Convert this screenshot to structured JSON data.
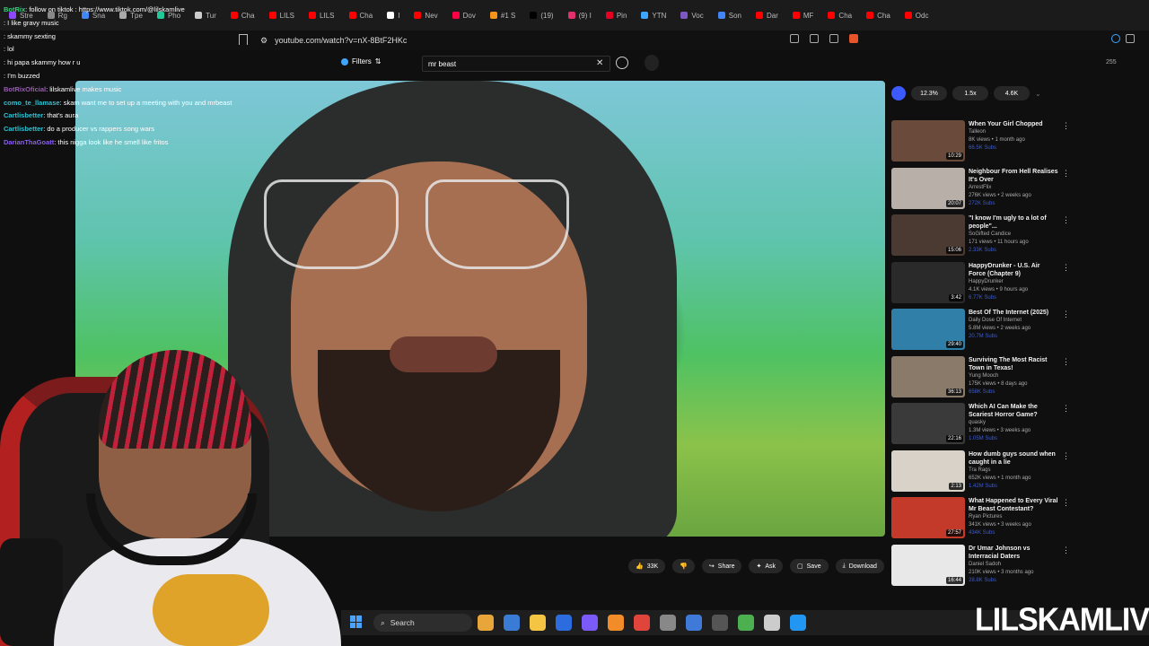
{
  "browser": {
    "tabs": [
      {
        "label": "Stre",
        "color": "#9146ff"
      },
      {
        "label": "Rg",
        "color": "#888888"
      },
      {
        "label": "Sna",
        "color": "#4285f4"
      },
      {
        "label": "Tpe",
        "color": "#aaaaaa"
      },
      {
        "label": "Pho",
        "color": "#20c997"
      },
      {
        "label": "Tur",
        "color": "#cccccc"
      },
      {
        "label": "Cha",
        "color": "#ff0000"
      },
      {
        "label": "LILS",
        "color": "#ff0000"
      },
      {
        "label": "LILS",
        "color": "#ff0000"
      },
      {
        "label": "Cha",
        "color": "#ff0000"
      },
      {
        "label": "I",
        "color": "#ffffff"
      },
      {
        "label": "Nev",
        "color": "#ff0000"
      },
      {
        "label": "Dov",
        "color": "#ff0044"
      },
      {
        "label": "#1 S",
        "color": "#f7931a"
      },
      {
        "label": "(19)",
        "color": "#000000"
      },
      {
        "label": "(9) I",
        "color": "#e1306c"
      },
      {
        "label": "Pin",
        "color": "#e60023"
      },
      {
        "label": "YTN",
        "color": "#3ea6ff"
      },
      {
        "label": "Voc",
        "color": "#7e57c2"
      },
      {
        "label": "Son",
        "color": "#4285f4"
      },
      {
        "label": "Dar",
        "color": "#ff0000"
      },
      {
        "label": "MF",
        "color": "#ff0000"
      },
      {
        "label": "Cha",
        "color": "#ff0000"
      },
      {
        "label": "Cha",
        "color": "#ff0000"
      },
      {
        "label": "Odc",
        "color": "#ff0000"
      }
    ],
    "url": "youtube.com/watch?v=nX-8BtF2HKc"
  },
  "youtube": {
    "filters_label": "Filters",
    "search_value": "mr beast",
    "top_right_count": "255"
  },
  "chips": [
    "12.3%",
    "1.5x",
    "4.6K"
  ],
  "actions": {
    "like_count": "33K",
    "share": "Share",
    "ask": "Ask",
    "save": "Save",
    "download": "Download"
  },
  "videos": [
    {
      "title": "When Your Girl Chopped",
      "channel": "Talleon",
      "stats": "8K views • 1 month ago",
      "subs": "66.5K Subs",
      "duration": "10:29",
      "bg": "#6a4a3a"
    },
    {
      "title": "Neighbour From Hell Realises It's Over",
      "channel": "ArrestFlix",
      "stats": "276K views • 2 weeks ago",
      "subs": "272K Subs",
      "duration": "20:07",
      "bg": "#b8b0a8"
    },
    {
      "title": "\"I know I'm ugly to a lot of people\"...",
      "channel": "SoGifted Candice",
      "stats": "171 views • 11 hours ago",
      "subs": "2.33K Subs",
      "duration": "15:06",
      "bg": "#4a3a32"
    },
    {
      "title": "HappyDrunker - U.S. Air Force (Chapter 9)",
      "channel": "HappyDrunker",
      "stats": "4.1K views • 9 hours ago",
      "subs": "6.77K Subs",
      "duration": "3:42",
      "bg": "#2a2a2a"
    },
    {
      "title": "Best Of The Internet (2025)",
      "channel": "Daily Dose Of Internet",
      "stats": "5.8M views • 2 weeks ago",
      "subs": "20.7M Subs",
      "duration": "29:40",
      "bg": "#2f7fa8"
    },
    {
      "title": "Surviving The Most Racist Town in Texas!",
      "channel": "Yung Mooch",
      "stats": "175K views • 8 days ago",
      "subs": "658K Subs",
      "duration": "36:13",
      "bg": "#8a7a6a"
    },
    {
      "title": "Which AI Can Make the Scariest Horror Game?",
      "channel": "quasky",
      "stats": "1.3M views • 3 weeks ago",
      "subs": "1.05M Subs",
      "duration": "22:16",
      "bg": "#3a3a3a"
    },
    {
      "title": "How dumb guys sound when caught in a lie",
      "channel": "Tra Rags",
      "stats": "652K views • 1 month ago",
      "subs": "1.42M Subs",
      "duration": "2:13",
      "bg": "#d8d2c8"
    },
    {
      "title": "What Happened to Every Viral Mr Beast Contestant?",
      "channel": "Ryan Pictures",
      "stats": "341K views • 3 weeks ago",
      "subs": "434K Subs",
      "duration": "27:57",
      "bg": "#c43a2a"
    },
    {
      "title": "Dr Umar Johnson vs Interracial Daters",
      "channel": "Daniel Sadoh",
      "stats": "210K views • 3 months ago",
      "subs": "28.8K Subs",
      "duration": "16:44",
      "bg": "#e8e8e8"
    }
  ],
  "chat": [
    {
      "user": "BotRix",
      "text": ": follow on tiktok : https://www.tiktok.com/@lilskamlive",
      "color": "#31d07a"
    },
    {
      "user": "",
      "text": ": I like gravy music",
      "color": "#d22b2b"
    },
    {
      "user": "",
      "text": ": skammy sexting",
      "color": "#d22b2b"
    },
    {
      "user": "",
      "text": ": lol",
      "color": "#d22b2b"
    },
    {
      "user": "",
      "text": ": hi papa skammy how r u",
      "color": "#d22b2b"
    },
    {
      "user": "",
      "text": ": I'm buzzed",
      "color": "#d22b2b"
    },
    {
      "user": "BotRixOficial",
      "text": ": lilskamlive makes music",
      "color": "#9b59b6"
    },
    {
      "user": "como_te_llamase",
      "text": ": skam want me to set up a meeting with you and mrbeast",
      "color": "#31c0d0"
    },
    {
      "user": "Cartlisbetter",
      "text": ": that's aura",
      "color": "#31c0d0"
    },
    {
      "user": "Cartlisbetter",
      "text": ": do a producer vs rappers song wars",
      "color": "#31c0d0"
    },
    {
      "user": "DarianThaGoatt",
      "text": ": this nigga look like he smell like fritos",
      "color": "#8a5cf0"
    }
  ],
  "taskbar": {
    "search_label": "Search",
    "apps": [
      "#e8a63a",
      "#3a7bd5",
      "#f4c542",
      "#2d6cdf",
      "#7a5af8",
      "#f28c28",
      "#e0443a",
      "#888888",
      "#3f7ad9",
      "#555555",
      "#4caf50",
      "#cccccc",
      "#2196f3"
    ]
  },
  "watermark": "LILSKAMLIVE"
}
